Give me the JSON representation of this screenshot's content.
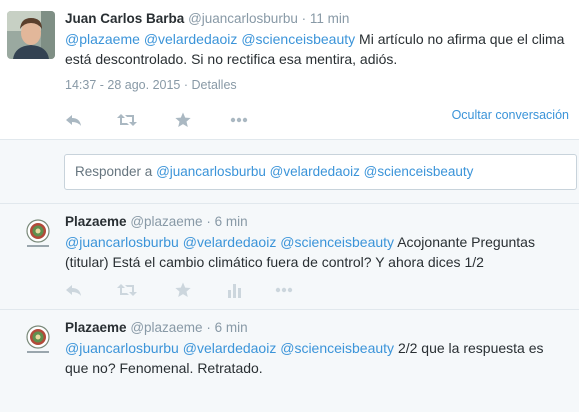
{
  "main_tweet": {
    "fullname": "Juan Carlos Barba",
    "username": "@juancarlosburbu",
    "separator": "·",
    "time": "11 min",
    "mentions": [
      "@plazaeme",
      "@velardedaoiz",
      "@scienceisbeauty"
    ],
    "text": "Mi artículo no afirma que el clima está descontrolado. Si no rectifica esa mentira, adiós.",
    "timestamp": "14:37 - 28 ago. 2015",
    "details": "Detalles",
    "hide_conversation": "Ocultar conversación"
  },
  "reply_box": {
    "prefix": "Responder a",
    "mentions": [
      "@juancarlosburbu",
      "@velardedaoiz",
      "@scienceisbeauty"
    ]
  },
  "replies": [
    {
      "fullname": "Plazaeme",
      "username": "@plazaeme",
      "separator": "·",
      "time": "6 min",
      "mentions": [
        "@juancarlosburbu",
        "@velardedaoiz",
        "@scienceisbeauty"
      ],
      "text": "Acojonante Preguntas (titular) Está el cambio climático fuera de control?  Y ahora dices 1/2"
    },
    {
      "fullname": "Plazaeme",
      "username": "@plazaeme",
      "separator": "·",
      "time": "6 min",
      "mentions": [
        "@juancarlosburbu",
        "@velardedaoiz",
        "@scienceisbeauty"
      ],
      "text": "2/2 que la respuesta es que no? Fenomenal. Retratado."
    }
  ],
  "colors": {
    "link": "#3b94d9",
    "muted": "#8899a6",
    "text": "#292f33",
    "background_alt": "#f5f8fa",
    "icon": "#aab8c2"
  },
  "icons": [
    "reply-icon",
    "retweet-icon",
    "favorite-icon",
    "more-icon",
    "analytics-icon"
  ]
}
